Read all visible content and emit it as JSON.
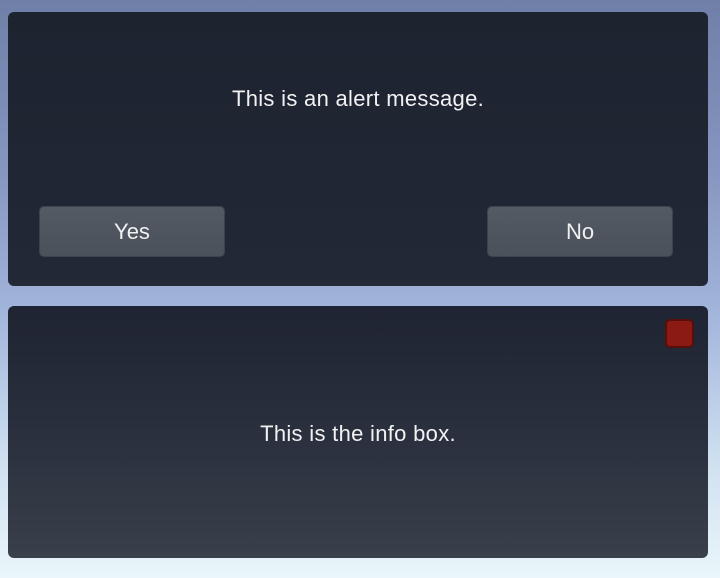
{
  "alert": {
    "message": "This is an alert message.",
    "yes_label": "Yes",
    "no_label": "No"
  },
  "info": {
    "message": "This is the info box.",
    "close_icon": "close-square-icon",
    "close_color": "#8c1a14"
  }
}
